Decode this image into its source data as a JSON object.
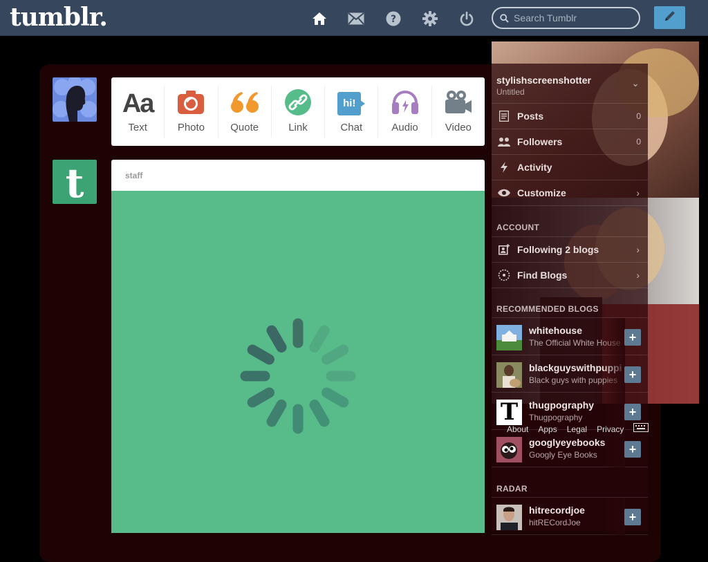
{
  "app": {
    "logo": "tumblr."
  },
  "nav": {
    "home": "home-icon",
    "messages": "envelope-icon",
    "help": "help-icon",
    "settings": "gear-icon",
    "logout": "power-icon"
  },
  "search": {
    "placeholder": "Search Tumblr"
  },
  "post_types": [
    {
      "label": "Text",
      "glyph": "Aa",
      "color": "#444444"
    },
    {
      "label": "Photo",
      "color": "#d95e40"
    },
    {
      "label": "Quote",
      "glyph": "“",
      "color": "#f2992e"
    },
    {
      "label": "Link",
      "color": "#56bc8a"
    },
    {
      "label": "Chat",
      "glyph": "hi!",
      "color": "#529ecc"
    },
    {
      "label": "Audio",
      "color": "#a77dc2"
    },
    {
      "label": "Video",
      "color": "#748089"
    }
  ],
  "post": {
    "author": "staff",
    "media_color": "#57bb8a"
  },
  "account_panel": {
    "blog_name": "stylishscreenshotter",
    "blog_title": "Untitled",
    "items": [
      {
        "label": "Posts",
        "count": "0"
      },
      {
        "label": "Followers",
        "count": "0"
      },
      {
        "label": "Activity"
      },
      {
        "label": "Customize"
      }
    ],
    "account_heading": "ACCOUNT",
    "account_items": [
      {
        "label": "Following 2 blogs"
      },
      {
        "label": "Find Blogs"
      }
    ],
    "recommended_heading": "RECOMMENDED BLOGS",
    "recommended": [
      {
        "name": "whitehouse",
        "subtitle": "The Official White House"
      },
      {
        "name": "blackguyswithpuppies",
        "subtitle": "Black guys with puppies"
      },
      {
        "name": "thugpography",
        "subtitle": "Thugpography",
        "avatar_glyph": "T"
      },
      {
        "name": "googlyeyebooks",
        "subtitle": "Googly Eye Books"
      }
    ],
    "follow_glyph": "+",
    "radar_heading": "RADAR",
    "radar": [
      {
        "name": "hitrecordjoe",
        "subtitle": "hitRECordJoe"
      }
    ],
    "footer_links": [
      "About",
      "Apps",
      "Legal",
      "Privacy"
    ]
  }
}
